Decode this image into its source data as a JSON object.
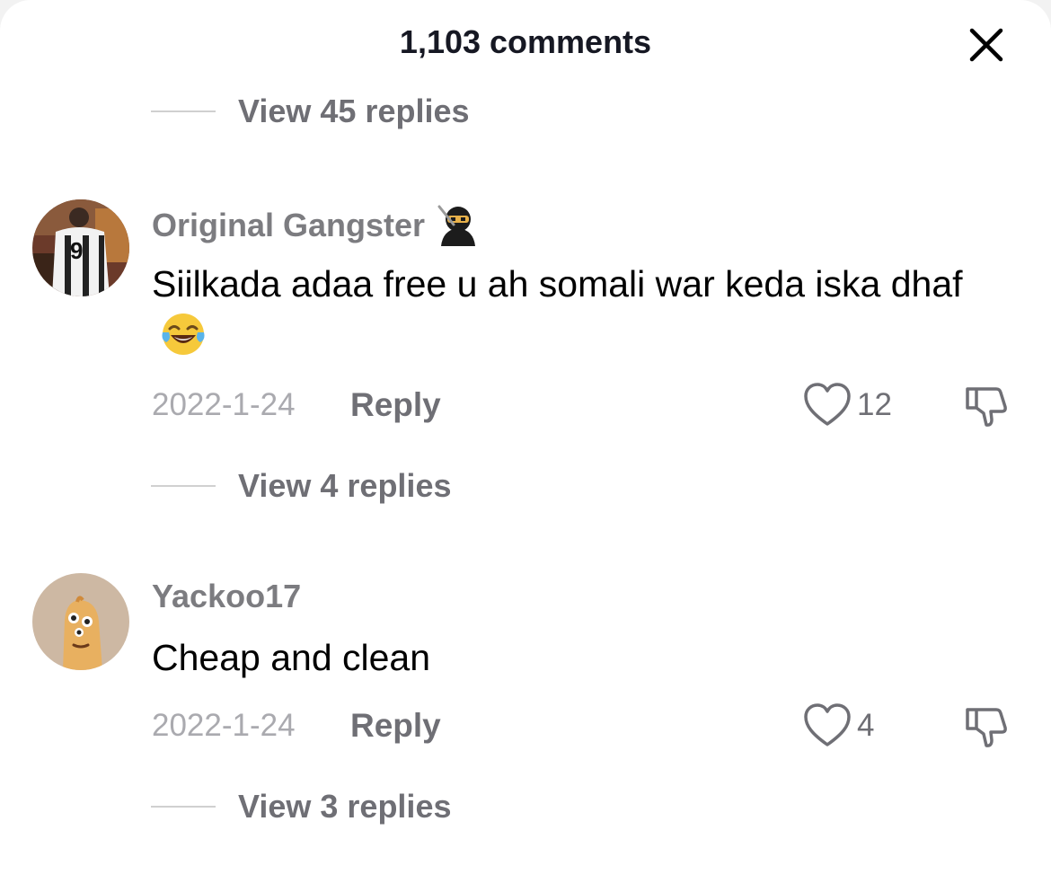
{
  "header": {
    "title": "1,103 comments",
    "close_icon": "close-icon"
  },
  "threads_above": {
    "view_replies_label": "View 45 replies"
  },
  "comments": [
    {
      "username": "Original Gangster",
      "username_emoji": "ninja-emoji",
      "text": "Siilkada adaa free u ah somali war keda iska dhaf",
      "text_emoji": "tears-of-joy-emoji",
      "date": "2022-1-24",
      "reply_label": "Reply",
      "likes": "12",
      "view_replies_label": "View 4 replies"
    },
    {
      "username": "Yackoo17",
      "text": "Cheap and clean",
      "date": "2022-1-24",
      "reply_label": "Reply",
      "likes": "4",
      "view_replies_label": "View 3 replies"
    }
  ],
  "colors": {
    "text_primary": "#000000",
    "text_secondary": "#6f6f75",
    "username": "#7c7c80",
    "date": "#aaaaaf"
  }
}
